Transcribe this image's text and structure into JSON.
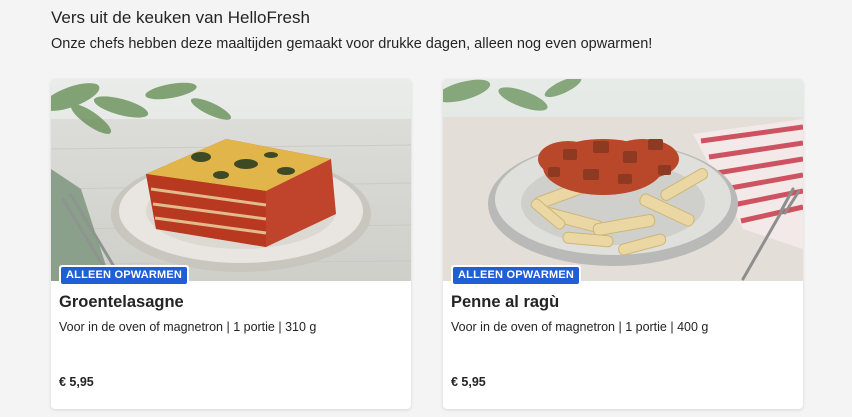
{
  "section": {
    "title": "Vers uit de keuken van HelloFresh",
    "subtitle": "Onze chefs hebben deze maaltijden gemaakt voor drukke dagen, alleen nog even opwarmen!"
  },
  "colors": {
    "badge_background": "#1f5ed6",
    "page_background": "#f4f4f4"
  },
  "products": [
    {
      "badge": "ALLEEN OPWARMEN",
      "name": "Groentelasagne",
      "description": "Voor in de oven of magnetron | 1 portie | 310 g",
      "price": "€ 5,95",
      "image": "lasagne-photo"
    },
    {
      "badge": "ALLEEN OPWARMEN",
      "name": "Penne al ragù",
      "description": "Voor in de oven of magnetron | 1 portie | 400 g",
      "price": "€ 5,95",
      "image": "penne-ragu-photo"
    }
  ]
}
